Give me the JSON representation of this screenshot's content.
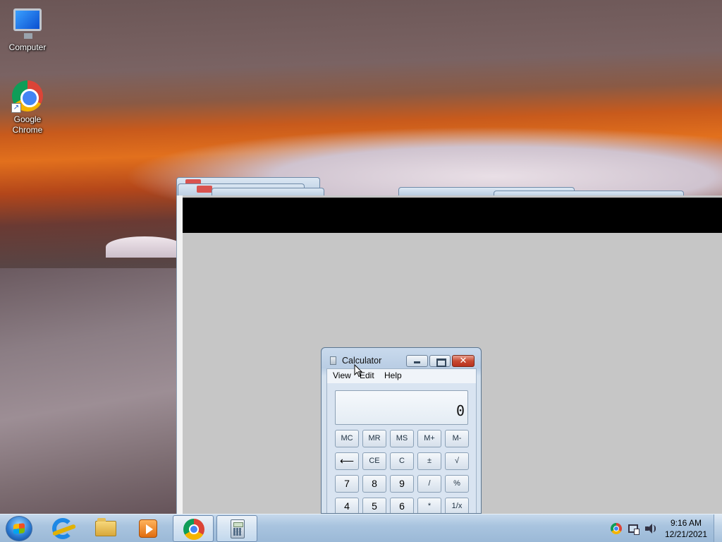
{
  "desktop": {
    "icons": [
      {
        "label": "Computer"
      },
      {
        "label": "Google Chrome"
      }
    ]
  },
  "calculator": {
    "title": "Calculator",
    "close_glyph": "✕",
    "menu": [
      "View",
      "Edit",
      "Help"
    ],
    "display": "0",
    "memory_row": [
      "MC",
      "MR",
      "MS",
      "M+",
      "M-"
    ],
    "row2": [
      "⟵",
      "CE",
      "C",
      "±",
      "√"
    ],
    "row3": [
      "7",
      "8",
      "9",
      "/",
      "%"
    ],
    "row4": [
      "4",
      "5",
      "6",
      "*",
      "1/x"
    ]
  },
  "taskbar": {
    "pinned": [
      "Internet Explorer",
      "Windows Explorer",
      "Windows Media Player",
      "Google Chrome",
      "Calculator"
    ],
    "tray": {
      "time": "9:16 AM",
      "date": "12/21/2021"
    }
  },
  "colors": {
    "taskbar": "#a9c4df",
    "window_gray": "#c6c6c6",
    "close_red": "#c84a32"
  }
}
